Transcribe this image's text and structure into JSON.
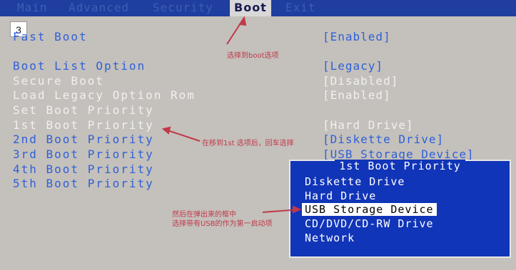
{
  "tabs": [
    "Main",
    "Advanced",
    "Security",
    "Boot",
    "Exit"
  ],
  "active_tab": "Boot",
  "page_no": "3",
  "settings": [
    {
      "label": "Fast Boot",
      "value": "[Enabled]"
    },
    {
      "label": "Boot List Option",
      "value": "[Legacy]"
    },
    {
      "label": "Secure Boot",
      "value": "[Disabled]"
    },
    {
      "label": "Load Legacy Option Rom",
      "value": "[Enabled]"
    },
    {
      "label": "Set Boot Priority",
      "value": ""
    },
    {
      "label": "1st Boot Priority",
      "value": "[Hard Drive]"
    },
    {
      "label": "2nd Boot Priority",
      "value": "[Diskette Drive]"
    },
    {
      "label": "3rd Boot Priority",
      "value": "[USB Storage Device]"
    },
    {
      "label": "4th Boot Priority",
      "value": ""
    },
    {
      "label": "5th Boot Priority",
      "value": ""
    }
  ],
  "popup": {
    "title": "1st Boot Priority",
    "options": [
      "Diskette Drive",
      "Hard Drive",
      "USB Storage Device",
      "CD/DVD/CD-RW Drive",
      "Network"
    ],
    "selected": "USB Storage Device"
  },
  "notes": {
    "top": "选择到boot选项",
    "middle": "在移到1st 选项后，回车选择",
    "bottom_1": "然后在弹出来的框中",
    "bottom_2": "选择带有USB的作为第一启动项"
  },
  "colors": {
    "bios_blue": "#1135b8",
    "highlight": "#2f61d8",
    "note_red": "#c0394a"
  }
}
